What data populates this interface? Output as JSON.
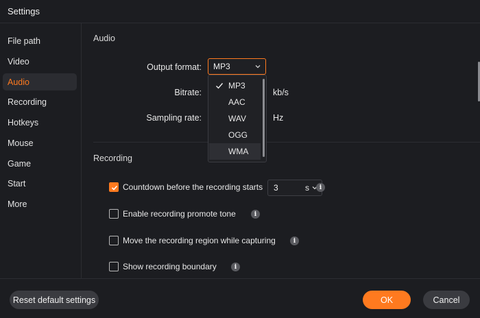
{
  "window": {
    "title": "Settings"
  },
  "sidebar": {
    "items": [
      {
        "label": "File path"
      },
      {
        "label": "Video"
      },
      {
        "label": "Audio",
        "active": true
      },
      {
        "label": "Recording"
      },
      {
        "label": "Hotkeys"
      },
      {
        "label": "Mouse"
      },
      {
        "label": "Game"
      },
      {
        "label": "Start"
      },
      {
        "label": "More"
      }
    ]
  },
  "audio": {
    "section_title": "Audio",
    "output_format_label": "Output format:",
    "output_format_value": "MP3",
    "bitrate_label": "Bitrate:",
    "bitrate_unit": "kb/s",
    "sampling_rate_label": "Sampling rate:",
    "sampling_rate_unit": "Hz",
    "dropdown_options": [
      "MP3",
      "AAC",
      "WAV",
      "OGG",
      "WMA"
    ],
    "dropdown_selected": "MP3",
    "dropdown_hovered": "WMA"
  },
  "recording": {
    "section_title": "Recording",
    "countdown": {
      "label": "Countdown before the recording starts",
      "checked": true,
      "value": "3",
      "unit": "s"
    },
    "promote_tone": {
      "label": "Enable recording promote tone",
      "checked": false
    },
    "move_region": {
      "label": "Move the recording region while capturing",
      "checked": false
    },
    "show_boundary": {
      "label": "Show recording boundary",
      "checked": false
    }
  },
  "info_glyph": "i",
  "footer": {
    "reset_label": "Reset default settings",
    "ok_label": "OK",
    "cancel_label": "Cancel"
  },
  "colors": {
    "accent": "#ff7a1f",
    "background": "#1c1d21",
    "button": "#3a3b40"
  }
}
